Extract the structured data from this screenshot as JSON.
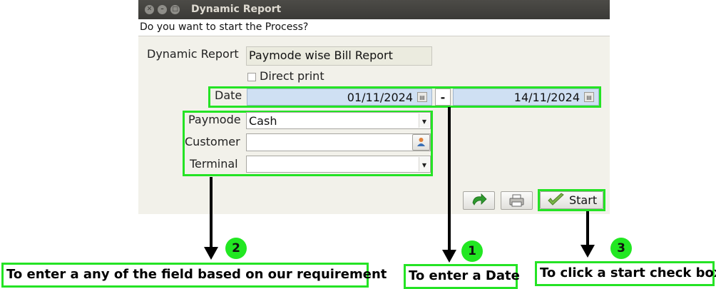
{
  "window": {
    "title": "Dynamic Report",
    "prompt": "Do you want to start the Process?"
  },
  "form": {
    "dynamic_report_label": "Dynamic Report",
    "dynamic_report_value": "Paymode wise Bill Report",
    "direct_print_label": "Direct print",
    "direct_print_checked": false,
    "date_label": "Date",
    "date_from": "01/11/2024",
    "date_separator": "-",
    "date_to": "14/11/2024",
    "paymode_label": "Paymode",
    "paymode_value": "Cash",
    "customer_label": "Customer",
    "customer_value": "",
    "terminal_label": "Terminal",
    "terminal_value": ""
  },
  "toolbar": {
    "start_label": "Start"
  },
  "annotations": {
    "step1_number": "1",
    "step1_text": "To enter a Date",
    "step2_number": "2",
    "step2_text": "To enter a  any of the field based on our requirement",
    "step3_number": "3",
    "step3_text": "To click a start check box"
  },
  "colors": {
    "highlight": "#24e324",
    "date_field": "#cfe0f3",
    "titlebar": "#3f3e3a"
  }
}
